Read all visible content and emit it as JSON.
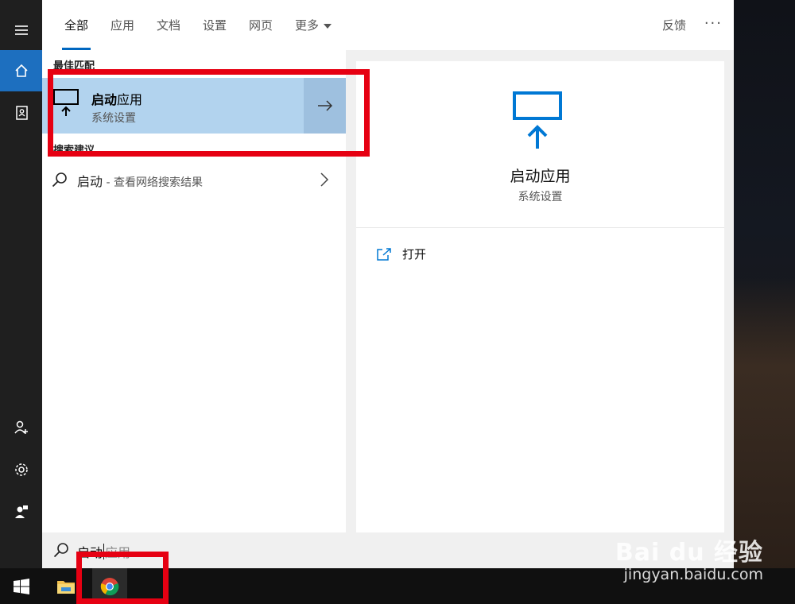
{
  "tabs": [
    {
      "label": "全部",
      "active": true
    },
    {
      "label": "应用"
    },
    {
      "label": "文档"
    },
    {
      "label": "设置"
    },
    {
      "label": "网页"
    },
    {
      "label": "更多"
    }
  ],
  "header": {
    "feedback": "反馈",
    "ellipsis": "···"
  },
  "best_match": {
    "title": "最佳匹配",
    "name_bold": "启动",
    "name_rest": "应用",
    "subtitle": "系统设置"
  },
  "suggestions": {
    "title": "搜索建议",
    "item_query": "启动",
    "item_hint": " - 查看网络搜索结果"
  },
  "preview": {
    "name": "启动应用",
    "subtitle": "系统设置",
    "action_open": "打开"
  },
  "searchbox": {
    "typed": "启动",
    "ghost": "应用"
  },
  "watermark": {
    "brand": "Bai du 经验",
    "url": "jingyan.baidu.com"
  },
  "colors": {
    "accent": "#0067c0",
    "selected_bg": "#b2d3ee",
    "rail_active": "#1d6fbf",
    "annotation": "#e60012"
  },
  "icons": [
    "hamburger-icon",
    "home-icon",
    "notebook-icon",
    "add-user-icon",
    "settings-gear-icon",
    "feedback-person-icon",
    "monitor-startup-icon",
    "arrow-right-icon",
    "search-icon",
    "chevron-right-icon",
    "open-external-icon",
    "windows-start-icon",
    "file-explorer-icon",
    "chrome-icon"
  ]
}
